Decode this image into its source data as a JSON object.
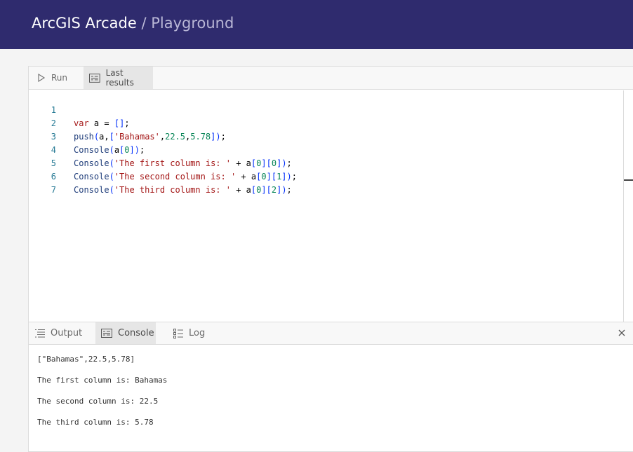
{
  "header": {
    "app_name": "ArcGIS Arcade",
    "separator": " / ",
    "page_name": "Playground"
  },
  "toolbar": {
    "run_label": "Run",
    "last_results_label": "Last results"
  },
  "editor": {
    "line_numbers": [
      "1",
      "2",
      "3",
      "4",
      "5",
      "6",
      "7"
    ],
    "lines": [
      "var a = [];",
      "push(a,['Bahamas',22.5,5.78]);",
      "Console(a[0]);",
      "Console('The first column is: ' + a[0][0]);",
      "Console('The second column is: ' + a[0][1]);",
      "Console('The third column is: ' + a[0][2]);",
      ""
    ]
  },
  "results": {
    "tabs": {
      "output": "Output",
      "console": "Console",
      "log": "Log"
    },
    "active_tab": "Console",
    "console_lines": [
      "[\"Bahamas\",22.5,5.78]",
      "The first column is: Bahamas",
      "The second column is: 22.5",
      "The third column is: 5.78"
    ]
  },
  "colors": {
    "header_bg": "#2f2b6e",
    "page_bg": "#f4f4f4"
  }
}
